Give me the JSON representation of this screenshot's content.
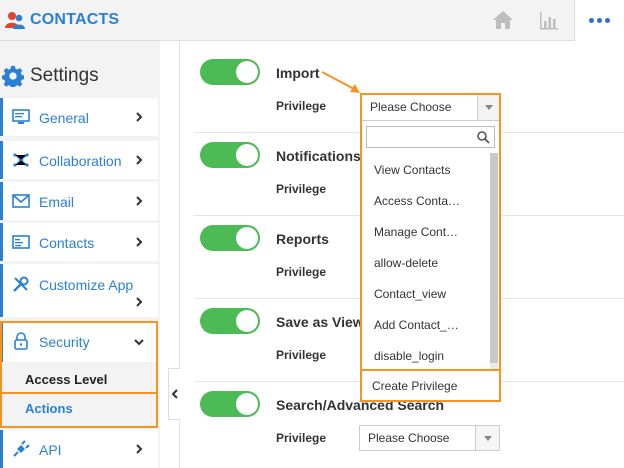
{
  "app": {
    "title": "CONTACTS"
  },
  "header": {
    "icons": [
      "home-icon",
      "chart-icon",
      "more-icon"
    ]
  },
  "sidebar": {
    "heading": "Settings",
    "items": [
      {
        "label": "General",
        "icon": "monitor-icon"
      },
      {
        "label": "Collaboration",
        "icon": "network-icon"
      },
      {
        "label": "Email",
        "icon": "envelope-icon"
      },
      {
        "label": "Contacts",
        "icon": "card-icon"
      },
      {
        "label": "Customize App",
        "icon": "tools-icon"
      },
      {
        "label": "Security",
        "icon": "lock-icon",
        "expanded": true
      },
      {
        "label": "API",
        "icon": "plug-icon"
      }
    ],
    "security_sub": [
      "Access Level",
      "Actions"
    ]
  },
  "main": {
    "privilege_label": "Privilege",
    "rows": [
      {
        "title": "Import",
        "enabled": true,
        "privilege": "Please Choose"
      },
      {
        "title": "Notifications",
        "enabled": true
      },
      {
        "title": "Reports",
        "enabled": true
      },
      {
        "title": "Save as View",
        "enabled": true
      },
      {
        "title": "Search/Advanced Search",
        "enabled": true,
        "privilege": "Please Choose"
      }
    ]
  },
  "dropdown": {
    "selected": "Please Choose",
    "search_placeholder": "",
    "options": [
      "View Contacts",
      "Access Conta…",
      "Manage Cont…",
      "allow-delete",
      "Contact_view",
      "Add Contact_…",
      "disable_login"
    ],
    "create_label": "Create Privilege"
  },
  "colors": {
    "accent": "#2a80d6",
    "highlight": "#f7931e",
    "toggle_on": "#4cbb55"
  }
}
